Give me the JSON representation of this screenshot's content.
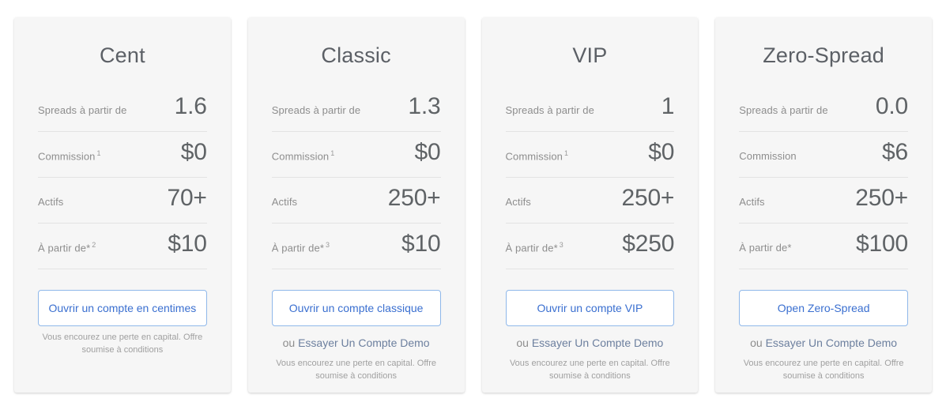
{
  "plans": [
    {
      "title": "Cent",
      "features": [
        {
          "label": "Spreads à partir de",
          "sup": "",
          "value": "1.6"
        },
        {
          "label": "Commission",
          "sup": "1",
          "value": "$0"
        },
        {
          "label": "Actifs",
          "sup": "",
          "value": "70+"
        },
        {
          "label": "À partir de*",
          "sup": "2",
          "value": "$10"
        }
      ],
      "cta_label": "Ouvrir un compte en centimes",
      "demo_prefix": "",
      "demo_link": "",
      "risk_note": "Vous encourez une perte en capital. Offre soumise à conditions"
    },
    {
      "title": "Classic",
      "features": [
        {
          "label": "Spreads à partir de",
          "sup": "",
          "value": "1.3"
        },
        {
          "label": "Commission",
          "sup": "1",
          "value": "$0"
        },
        {
          "label": "Actifs",
          "sup": "",
          "value": "250+"
        },
        {
          "label": "À partir de*",
          "sup": "3",
          "value": "$10"
        }
      ],
      "cta_label": "Ouvrir un compte classique",
      "demo_prefix": "ou ",
      "demo_link": "Essayer Un Compte Demo",
      "risk_note": "Vous encourez une perte en capital. Offre soumise à conditions"
    },
    {
      "title": "VIP",
      "features": [
        {
          "label": "Spreads à partir de",
          "sup": "",
          "value": "1"
        },
        {
          "label": "Commission",
          "sup": "1",
          "value": "$0"
        },
        {
          "label": "Actifs",
          "sup": "",
          "value": "250+"
        },
        {
          "label": "À partir de*",
          "sup": "3",
          "value": "$250"
        }
      ],
      "cta_label": "Ouvrir un compte VIP",
      "demo_prefix": "ou ",
      "demo_link": "Essayer Un Compte Demo",
      "risk_note": "Vous encourez une perte en capital. Offre soumise à conditions"
    },
    {
      "title": "Zero-Spread",
      "features": [
        {
          "label": "Spreads à partir de",
          "sup": "",
          "value": "0.0"
        },
        {
          "label": "Commission",
          "sup": "",
          "value": "$6"
        },
        {
          "label": "Actifs",
          "sup": "",
          "value": "250+"
        },
        {
          "label": "À partir de*",
          "sup": "",
          "value": "$100"
        }
      ],
      "cta_label": "Open Zero-Spread",
      "demo_prefix": "ou ",
      "demo_link": "Essayer Un Compte Demo",
      "risk_note": "Vous encourez une perte en capital. Offre soumise à conditions"
    }
  ],
  "colors": {
    "card_background": "#f6f6f6",
    "page_background": "#ffffff",
    "title_text": "#5c6066",
    "label_text": "#8d8d8d",
    "value_text": "#5f6366",
    "button_border": "#8fb8ea",
    "button_text": "#3a6fd0",
    "demo_link_text": "#6c7f9e",
    "risk_note_text": "#a0a0a0",
    "divider": "#e3e3e3"
  }
}
